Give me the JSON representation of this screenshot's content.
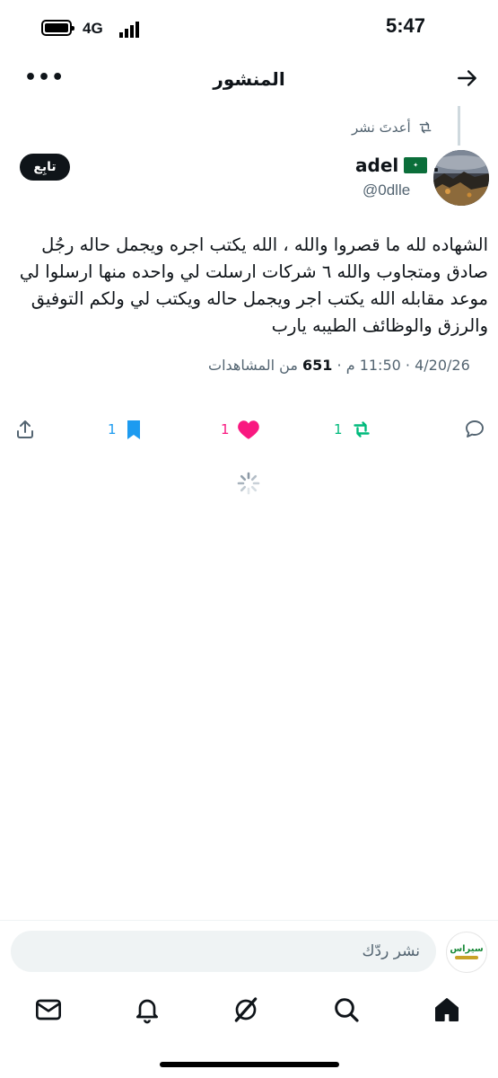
{
  "status_bar": {
    "time": "5:47",
    "network": "4G"
  },
  "header": {
    "title": "المنشور"
  },
  "repost_context": {
    "label": "أعدتَ نشر"
  },
  "author": {
    "name": "adel",
    "name_suffix": ".",
    "handle": "@0dlle",
    "flag_text": "لا إله إلا الله"
  },
  "follow_button": {
    "label": "تابِع"
  },
  "post": {
    "text": "الشهاده لله ما قصروا والله ، الله يكتب اجره ويجمل حاله رجُل صادق ومتجاوب والله ٦ شركات ارسلت لي واحده منها ارسلوا لي موعد مقابله الله يكتب اجر ويجمل حاله ويكتب لي ولكم التوفيق والرزق والوظائف الطيبه يارب",
    "date": "4/20/26",
    "time": "11:50 م",
    "separator": "·",
    "views_count": "651",
    "views_label": "من المشاهدات"
  },
  "actions": {
    "reply_count": "",
    "repost_count": "1",
    "like_count": "1",
    "bookmark_count": "1"
  },
  "reply_bar": {
    "placeholder": "نشر ردّك",
    "avatar_text": "سيراس"
  },
  "colors": {
    "repost": "#00ba7c",
    "like": "#f91880",
    "bookmark": "#1d9bf0",
    "muted": "#536471",
    "text": "#0f1419"
  }
}
